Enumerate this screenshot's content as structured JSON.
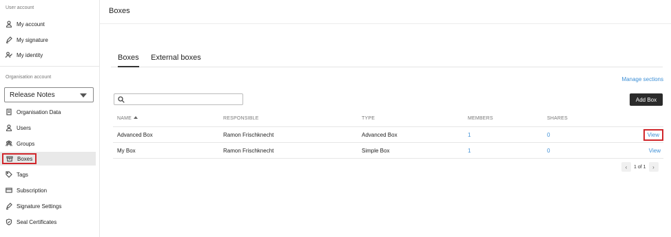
{
  "sidebar": {
    "user_section_label": "User account",
    "user_items": [
      {
        "label": "My account",
        "icon": "person-icon"
      },
      {
        "label": "My signature",
        "icon": "pen-icon"
      },
      {
        "label": "My identity",
        "icon": "identity-icon"
      }
    ],
    "org_section_label": "Organisation account",
    "org_select_value": "Release Notes",
    "org_items": [
      {
        "label": "Organisation Data",
        "icon": "document-icon"
      },
      {
        "label": "Users",
        "icon": "person-icon"
      },
      {
        "label": "Groups",
        "icon": "group-icon"
      },
      {
        "label": "Boxes",
        "icon": "box-icon",
        "active": true
      },
      {
        "label": "Tags",
        "icon": "tag-icon"
      },
      {
        "label": "Subscription",
        "icon": "card-icon"
      },
      {
        "label": "Signature Settings",
        "icon": "pen-icon"
      },
      {
        "label": "Seal Certificates",
        "icon": "shield-icon"
      }
    ]
  },
  "main": {
    "title": "Boxes",
    "tabs": [
      {
        "label": "Boxes",
        "active": true
      },
      {
        "label": "External boxes",
        "active": false
      }
    ],
    "manage_sections_label": "Manage sections",
    "search": {
      "value": "",
      "placeholder": ""
    },
    "add_button_label": "Add Box",
    "table": {
      "headers": {
        "name": "NAME",
        "responsible": "RESPONSIBLE",
        "type": "TYPE",
        "members": "MEMBERS",
        "shares": "SHARES"
      },
      "rows": [
        {
          "name": "Advanced Box",
          "responsible": "Ramon Frischknecht",
          "type": "Advanced Box",
          "members": "1",
          "shares": "0",
          "action": "View"
        },
        {
          "name": "My Box",
          "responsible": "Ramon Frischknecht",
          "type": "Simple Box",
          "members": "1",
          "shares": "0",
          "action": "View"
        }
      ]
    },
    "pagination": {
      "text": "1 of 1",
      "prev": "‹",
      "next": "›"
    }
  },
  "colors": {
    "accent_link": "#3d8fd6",
    "highlight_box": "#d0262b",
    "button_dark": "#2b2b2b"
  }
}
